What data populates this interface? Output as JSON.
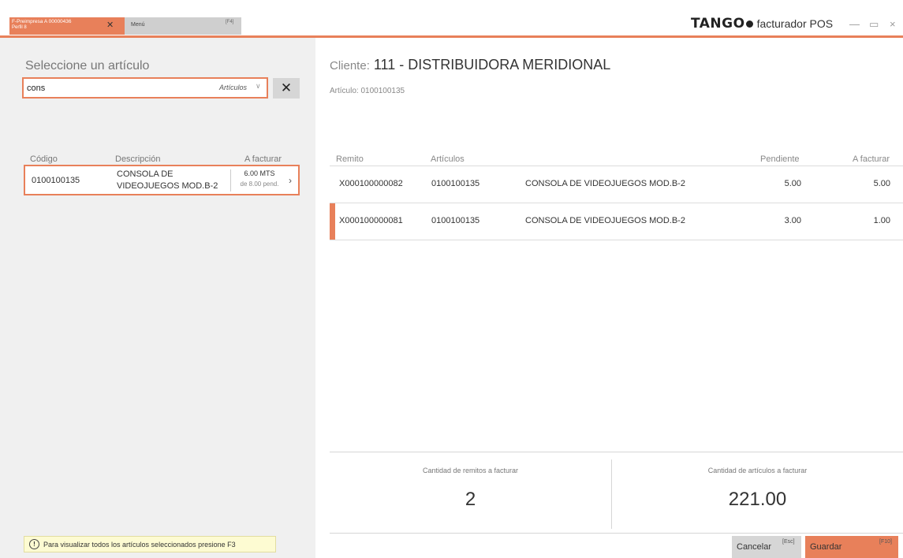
{
  "titlebar": {
    "tab_active_line1": "F-Preimpresa A 00000436",
    "tab_active_line2": "Perfil 8",
    "tab_menu_label": "Menú",
    "tab_menu_key": "[F4]",
    "brand": "TANGO",
    "product": "facturador POS",
    "minimize": "—",
    "maximize": "▭",
    "close": "×"
  },
  "left": {
    "title": "Seleccione un artículo",
    "search_value": "cons",
    "search_category": "Artículos",
    "columns": [
      "Código",
      "Descripción",
      "A facturar"
    ],
    "item": {
      "code": "0100100135",
      "desc_line1": "CONSOLA DE",
      "desc_line2": "VIDEOJUEGOS MOD.B-2",
      "qty": "6.00 MTS",
      "pending": "de 8.00 pend."
    },
    "hint": "Para visualizar todos los artículos seleccionados presione F3"
  },
  "right": {
    "client_label": "Cliente:",
    "client_code": "111",
    "client_sep": "-",
    "client_name": "DISTRIBUIDORA MERIDIONAL",
    "articulo": "Artículo: 0100100135",
    "columns": [
      "Remito",
      "Artículos",
      "Pendiente",
      "A facturar"
    ],
    "rows": [
      {
        "remito": "X000100000082",
        "articulo": "0100100135",
        "descripcion": "CONSOLA DE VIDEOJUEGOS MOD.B-2",
        "pendiente": "5.00",
        "a_facturar": "5.00"
      },
      {
        "remito": "X000100000081",
        "articulo": "0100100135",
        "descripcion": "CONSOLA DE VIDEOJUEGOS MOD.B-2",
        "pendiente": "3.00",
        "a_facturar": "1.00"
      }
    ],
    "summary": {
      "remitos_label": "Cantidad de remitos a facturar",
      "remitos_value": "2",
      "articulos_label": "Cantidad de artículos a facturar",
      "articulos_value": "221.00"
    },
    "cancel_label": "Cancelar",
    "cancel_key": "[Esc]",
    "save_label": "Guardar",
    "save_key": "[F10]"
  },
  "colors": {
    "accent": "#e8805a",
    "panel": "#f0f0f0",
    "hint_bg": "#fdfbd2"
  }
}
